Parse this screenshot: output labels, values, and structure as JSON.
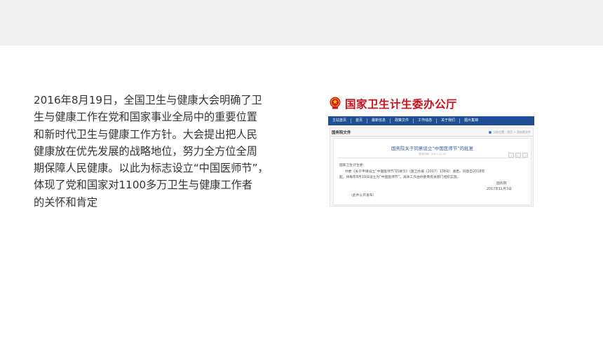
{
  "paragraph": {
    "lines": [
      "2016年8月19日，全国卫生与健康大会明确了卫",
      "生与健康工作在党和国家事业全局中的重要位置",
      "和新时代卫生与健康工作方针。大会提出把人民",
      "健康放在优先发展的战略地位，努力全方位全周",
      "期保障人民健康。以此为标志设立“中国医师节”，",
      "体现了党和国家对1100多万卫生与健康工作者",
      "的关怀和肯定"
    ]
  },
  "screenshot": {
    "site_title": "国家卫生计生委办公厅",
    "nav": [
      "主站首页",
      "首页",
      "最新信息",
      "政策文件",
      "工作动态",
      "关于我们",
      "图片集锦"
    ],
    "section_label": "国务院文件",
    "breadcrumb": "当前位置：首页 > 国务院文件",
    "doc_title": "国务院关于同意设立“中国医师节”的批复",
    "doc_meta": "发布时间：2017-11-23",
    "salutation": "国家卫生计生委：",
    "body_line1": "你委《关于申请设立“中国医师节”的请示》（国卫办报〔2017〕138号）收悉。同意自2018年",
    "body_line2": "起，将每年8月19日设立为“中国医师节”。具体工作由你委商有关部门组织实施。",
    "signature": "国务院",
    "date": "2017年11月3日",
    "footer_note": "（此件公开发布）"
  }
}
